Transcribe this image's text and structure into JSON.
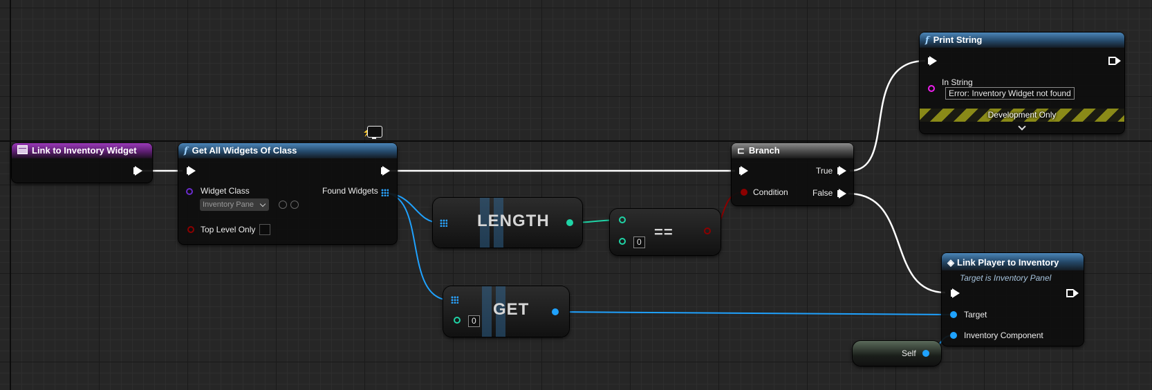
{
  "nodes": {
    "event": {
      "title": "Link to Inventory Widget"
    },
    "get_all_widgets": {
      "title": "Get All Widgets Of Class",
      "widget_class_label": "Widget Class",
      "widget_class_value": "Inventory Pane",
      "top_level_only_label": "Top Level Only",
      "found_widgets_label": "Found Widgets"
    },
    "length": {
      "title": "LENGTH"
    },
    "equals": {
      "title": "==",
      "literal": "0"
    },
    "get": {
      "title": "GET",
      "index_literal": "0"
    },
    "branch": {
      "title": "Branch",
      "condition_label": "Condition",
      "true_label": "True",
      "false_label": "False"
    },
    "print_string": {
      "title": "Print String",
      "in_string_label": "In String",
      "in_string_value": "Error: Inventory Widget not found",
      "development_only": "Development Only"
    },
    "link_player": {
      "title": "Link Player to Inventory",
      "subtitle": "Target is Inventory Panel",
      "target_label": "Target",
      "inventory_component_label": "Inventory Component"
    },
    "self": {
      "title": "Self"
    }
  },
  "colors": {
    "exec": "#ffffff",
    "object_pin": "#1fa2ff",
    "int_pin": "#1fd4a6",
    "bool_pin": "#8c0000",
    "class_pin": "#6a2ccc",
    "string_pin": "#f01ef0"
  }
}
